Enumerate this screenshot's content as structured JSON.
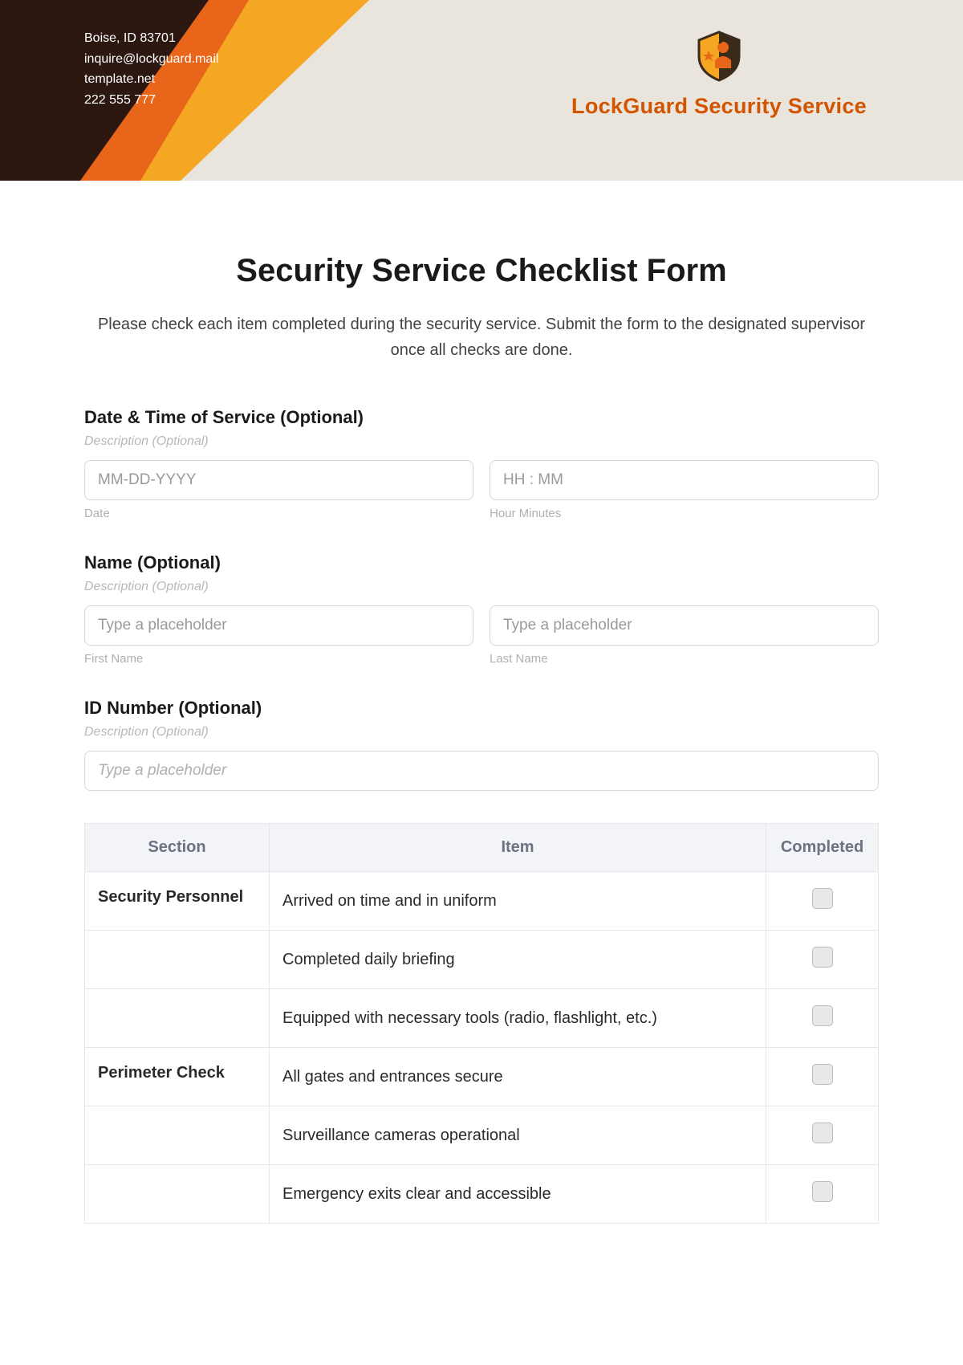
{
  "header": {
    "contact": {
      "line1": "Boise, ID 83701",
      "line2": "inquire@lockguard.mail",
      "line3": "template.net",
      "line4": "222 555 777"
    },
    "brand": "LockGuard Security Service"
  },
  "form": {
    "title": "Security Service Checklist Form",
    "subtitle": "Please check each item completed during the security service. Submit the form to the designated supervisor once all checks are done.",
    "datetime": {
      "label": "Date & Time of Service (Optional)",
      "desc": "Description (Optional)",
      "date_placeholder": "MM-DD-YYYY",
      "date_sublabel": "Date",
      "time_placeholder": "HH : MM",
      "time_sublabel": "Hour Minutes"
    },
    "name": {
      "label": "Name (Optional)",
      "desc": "Description (Optional)",
      "first_placeholder": "Type a placeholder",
      "first_sublabel": "First Name",
      "last_placeholder": "Type a placeholder",
      "last_sublabel": "Last Name"
    },
    "idnum": {
      "label": "ID Number (Optional)",
      "desc": "Description (Optional)",
      "placeholder": "Type a placeholder"
    },
    "table": {
      "headers": {
        "section": "Section",
        "item": "Item",
        "completed": "Completed"
      },
      "rows": [
        {
          "section": "Security Personnel",
          "item": "Arrived on time and in uniform"
        },
        {
          "section": "",
          "item": "Completed daily briefing"
        },
        {
          "section": "",
          "item": "Equipped with necessary tools (radio, flashlight, etc.)"
        },
        {
          "section": "Perimeter Check",
          "item": "All gates and entrances secure"
        },
        {
          "section": "",
          "item": "Surveillance cameras operational"
        },
        {
          "section": "",
          "item": "Emergency exits clear and accessible"
        }
      ]
    }
  }
}
